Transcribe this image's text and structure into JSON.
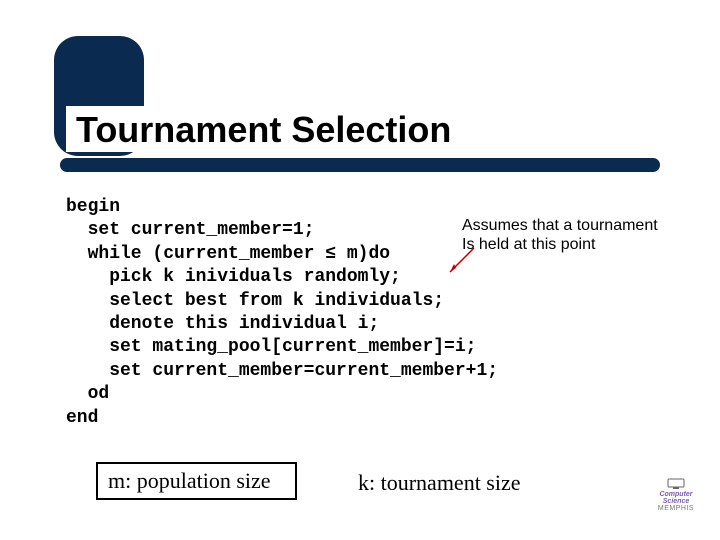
{
  "title": "Tournament Selection",
  "code_lines": [
    "begin",
    "  set current_member=1;",
    "  while (current_member ≤ m)do",
    "    pick k inividuals randomly;",
    "    select best from k individuals;",
    "    denote this individual i;",
    "    set mating_pool[current_member]=i;",
    "    set current_member=current_member+1;",
    "  od",
    "end"
  ],
  "annotation": {
    "line1": "Assumes that a tournament",
    "line2": "Is held at this point"
  },
  "legend_m": "m: population size",
  "legend_k": "k: tournament size",
  "logo": {
    "top": "Computer",
    "mid": "Science",
    "bottom": "MEMPHIS"
  }
}
